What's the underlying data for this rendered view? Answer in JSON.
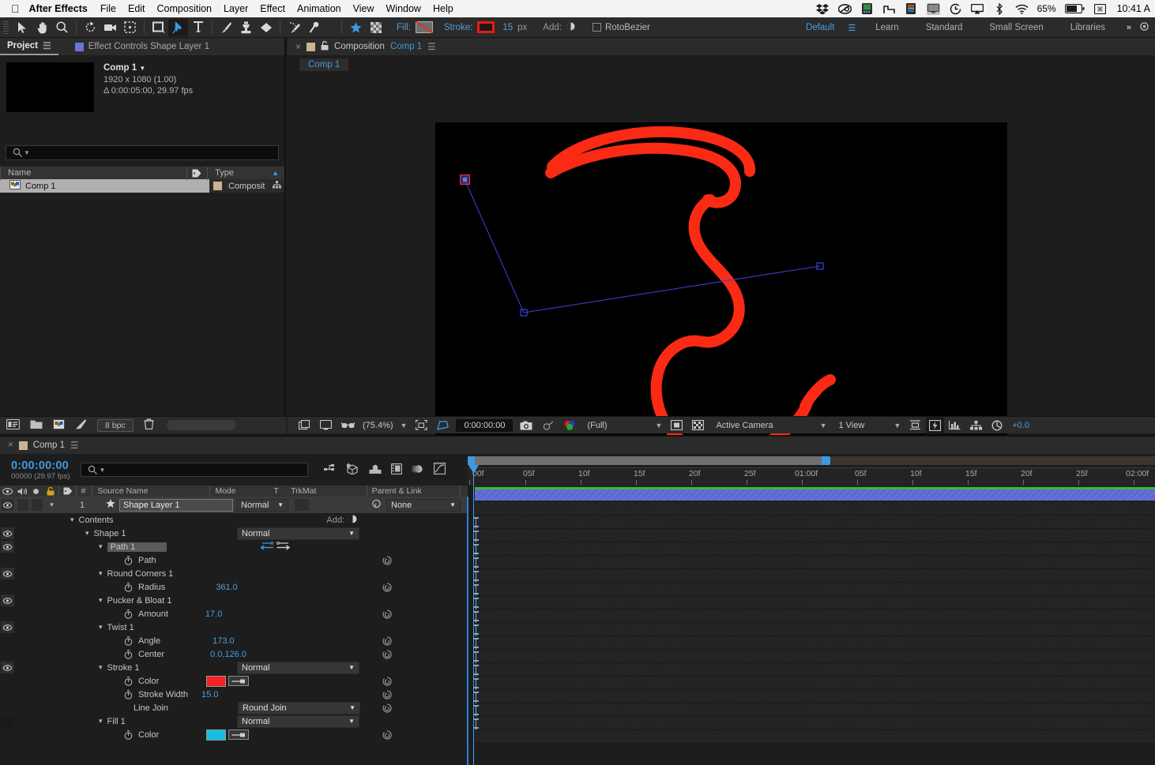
{
  "macbar": {
    "apple": "apple-logo",
    "app_name": "After Effects",
    "menus": [
      "File",
      "Edit",
      "Composition",
      "Layer",
      "Effect",
      "Animation",
      "View",
      "Window",
      "Help"
    ],
    "battery": "65%",
    "clock": "10:41 A",
    "sys_icons": [
      "dropbox-icon",
      "creative-cloud-icon",
      "drive-icon",
      "display-arrange-icon",
      "color-meter-icon",
      "screen-icon",
      "time-machine-icon",
      "airplay-icon",
      "bluetooth-icon",
      "wifi-icon",
      "battery-icon",
      "keyboard-input-icon"
    ]
  },
  "toolbar": {
    "tools": [
      {
        "name": "selection-tool",
        "selected": false
      },
      {
        "name": "hand-tool",
        "selected": false
      },
      {
        "name": "zoom-tool",
        "selected": false
      },
      {
        "name": "rotation-tool",
        "selected": false
      },
      {
        "name": "camera-tool",
        "selected": false
      },
      {
        "name": "anchor-point-tool",
        "selected": false
      },
      {
        "name": "shape-tool",
        "selected": false
      },
      {
        "name": "pen-tool",
        "selected": true
      },
      {
        "name": "type-tool",
        "selected": false
      },
      {
        "name": "brush-tool",
        "selected": false
      },
      {
        "name": "clone-stamp-tool",
        "selected": false
      },
      {
        "name": "eraser-tool",
        "selected": false
      },
      {
        "name": "roto-brush-tool",
        "selected": false
      },
      {
        "name": "puppet-pin-tool",
        "selected": false
      }
    ],
    "fill_label": "Fill:",
    "stroke_label": "Stroke:",
    "stroke_width": "15",
    "stroke_unit": "px",
    "stroke_color": "#ee1a12",
    "add_label": "Add:",
    "rotobezier_label": "RotoBezier",
    "rotobezier_checked": false
  },
  "workspaces": {
    "items": [
      "Default",
      "Learn",
      "Standard",
      "Small Screen",
      "Libraries"
    ],
    "active": "Default",
    "overflow": "»"
  },
  "project_panel": {
    "tab_active": "Project",
    "tab_inactive": "Effect Controls Shape Layer 1",
    "comp_name": "Comp 1",
    "dimensions": "1920 x 1080 (1.00)",
    "duration": "Δ 0:00:05:00, 29.97 fps",
    "search_placeholder": "",
    "columns": [
      "Name",
      "Type"
    ],
    "rows": [
      {
        "name": "Comp 1",
        "type": "Composit"
      }
    ],
    "bpc": "8 bpc"
  },
  "comp_panel": {
    "tab_title": "Composition",
    "tab_comp": "Comp 1",
    "breadcrumb": "Comp 1",
    "zoom": "(75.4%)",
    "timecode": "0:00:00:00",
    "resolution": "(Full)",
    "camera": "Active Camera",
    "views": "1 View",
    "exposure": "+0.0"
  },
  "timeline": {
    "tab_name": "Comp 1",
    "current_time": "0:00:00:00",
    "frame_info": "00000 (29.97 fps)",
    "search_placeholder": "",
    "columns": [
      "#",
      "Source Name",
      "Mode",
      "T",
      "TrkMat",
      "Parent & Link"
    ],
    "ruler_labels": [
      "00f",
      "05f",
      "10f",
      "15f",
      "20f",
      "25f",
      "01:00f",
      "05f",
      "10f",
      "15f",
      "20f",
      "25f",
      "02:00f"
    ],
    "add_label": "Add:",
    "layer": {
      "number": "1",
      "source_name": "Shape Layer 1",
      "mode": "Normal",
      "parent": "None"
    },
    "properties": [
      {
        "indent": 1,
        "label": "Contents",
        "type": "group",
        "eye": false,
        "add": "Add:"
      },
      {
        "indent": 2,
        "label": "Shape 1",
        "type": "group",
        "eye": true,
        "mode": "Normal"
      },
      {
        "indent": 3,
        "label": "Path 1",
        "type": "group-highlight",
        "eye": true
      },
      {
        "indent": 4,
        "label": "Path",
        "type": "prop",
        "eye": false,
        "stopwatch": true
      },
      {
        "indent": 3,
        "label": "Round Corners 1",
        "type": "group",
        "eye": true
      },
      {
        "indent": 4,
        "label": "Radius",
        "type": "prop",
        "value": "361.0",
        "stopwatch": true
      },
      {
        "indent": 3,
        "label": "Pucker & Bloat 1",
        "type": "group",
        "eye": true
      },
      {
        "indent": 4,
        "label": "Amount",
        "type": "prop",
        "value": "17.0",
        "stopwatch": true
      },
      {
        "indent": 3,
        "label": "Twist 1",
        "type": "group",
        "eye": true
      },
      {
        "indent": 4,
        "label": "Angle",
        "type": "prop",
        "value": "173.0",
        "stopwatch": true
      },
      {
        "indent": 4,
        "label": "Center",
        "type": "prop",
        "value": "0.0,126.0",
        "stopwatch": true
      },
      {
        "indent": 3,
        "label": "Stroke 1",
        "type": "group",
        "eye": true,
        "mode": "Normal"
      },
      {
        "indent": 4,
        "label": "Color",
        "type": "color",
        "color": "#f42222",
        "stopwatch": true
      },
      {
        "indent": 4,
        "label": "Stroke Width",
        "type": "prop",
        "value": "15.0",
        "stopwatch": true
      },
      {
        "indent": 4,
        "label": "Line Join",
        "type": "dropdown",
        "value": "Round Join"
      },
      {
        "indent": 3,
        "label": "Fill 1",
        "type": "group",
        "eye": false,
        "mode": "Normal"
      },
      {
        "indent": 4,
        "label": "Color",
        "type": "color",
        "color": "#19bde0",
        "stopwatch": true
      }
    ]
  },
  "canvas": {
    "background": "#000000",
    "stroke_color": "#fa2a14",
    "path_color": "#3a46d8"
  }
}
